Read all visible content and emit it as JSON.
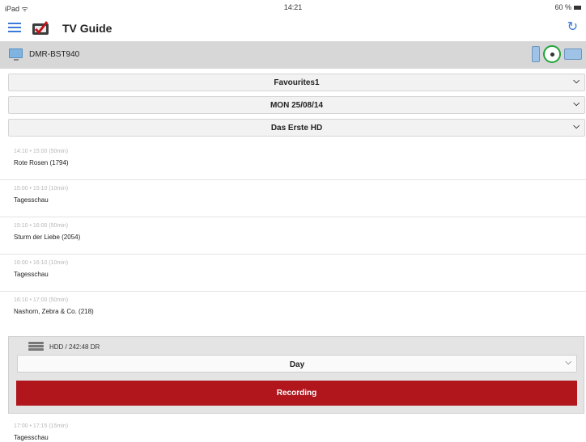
{
  "status_bar": {
    "carrier": "iPad ᯤ",
    "time": "14:21",
    "battery": "60 %"
  },
  "header": {
    "title": "TV Guide",
    "refresh_icon": "refresh-icon",
    "menu_icon": "hamburger-menu-icon"
  },
  "device": {
    "name": "DMR-BST940"
  },
  "selectors": {
    "favourites": "Favourites1",
    "date": "MON 25/08/14",
    "channel": "Das Erste HD"
  },
  "programs": [
    {
      "time": "14:10 • 15:00 (50min)",
      "title": "Rote Rosen (1794)"
    },
    {
      "time": "15:00 • 15:10 (10min)",
      "title": "Tagesschau"
    },
    {
      "time": "15:10 • 16:00 (50min)",
      "title": "Sturm der Liebe (2054)"
    },
    {
      "time": "16:00 • 16:10 (10min)",
      "title": "Tagesschau"
    },
    {
      "time": "16:10 • 17:00 (50min)",
      "title": "Nashorn, Zebra & Co. (218)"
    },
    {
      "time": "17:00 • 17:15 (15min)",
      "title": "Tagesschau"
    }
  ],
  "recording": {
    "storage": "HDD / 242:48 DR",
    "frequency": "Day",
    "button_label": "Recording",
    "button_color": "#b0161c"
  },
  "colors": {
    "accent": "#3a7bd5",
    "device_bar": "#d7d7d7",
    "connected": "#23a33b"
  }
}
